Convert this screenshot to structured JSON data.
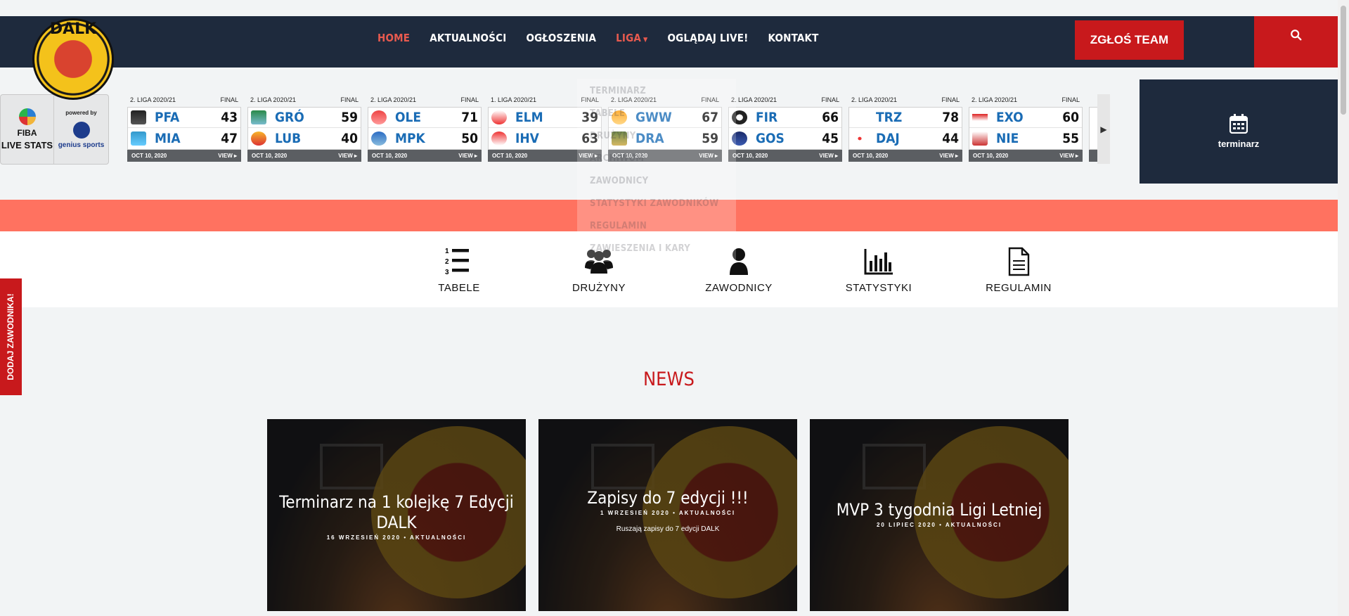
{
  "nav": {
    "home": "HOME",
    "aktualnosci": "AKTUALNOŚCI",
    "ogloszenia": "OGŁOSZENIA",
    "liga": "LIGA",
    "ogladaj": "OGLĄDAJ LIVE!",
    "kontakt": "KONTAKT"
  },
  "cta_label": "ZGŁOŚ TEAM",
  "logo_text": "DALK",
  "livestats": {
    "fiba": "FIBA",
    "title": "LIVE STATS",
    "powered": "powered by",
    "brand": "genius sports"
  },
  "games": [
    {
      "league": "2. LIGA 2020/21",
      "status": "FINAL",
      "date": "OCT 10, 2020",
      "view": "VIEW",
      "home": "PFA",
      "home_score": "43",
      "away": "MIA",
      "away_score": "47"
    },
    {
      "league": "2. LIGA 2020/21",
      "status": "FINAL",
      "date": "OCT 10, 2020",
      "view": "VIEW",
      "home": "GRÓ",
      "home_score": "59",
      "away": "LUB",
      "away_score": "40"
    },
    {
      "league": "2. LIGA 2020/21",
      "status": "FINAL",
      "date": "OCT 10, 2020",
      "view": "VIEW",
      "home": "OLE",
      "home_score": "71",
      "away": "MPK",
      "away_score": "50"
    },
    {
      "league": "1. LIGA 2020/21",
      "status": "FINAL",
      "date": "OCT 10, 2020",
      "view": "VIEW",
      "home": "ELM",
      "home_score": "39",
      "away": "IHV",
      "away_score": "63"
    },
    {
      "league": "2. LIGA 2020/21",
      "status": "FINAL",
      "date": "OCT 10, 2020",
      "view": "VIEW",
      "home": "GWW",
      "home_score": "67",
      "away": "DRA",
      "away_score": "59"
    },
    {
      "league": "2. LIGA 2020/21",
      "status": "FINAL",
      "date": "OCT 10, 2020",
      "view": "VIEW",
      "home": "FIR",
      "home_score": "66",
      "away": "GOS",
      "away_score": "45"
    },
    {
      "league": "2. LIGA 2020/21",
      "status": "FINAL",
      "date": "OCT 10, 2020",
      "view": "VIEW",
      "home": "TRZ",
      "home_score": "78",
      "away": "DAJ",
      "away_score": "44"
    },
    {
      "league": "2. LIGA 2020/21",
      "status": "FINAL",
      "date": "OCT 10, 2020",
      "view": "VIEW",
      "home": "EXO",
      "home_score": "60",
      "away": "NIE",
      "away_score": "55"
    }
  ],
  "terminarz_label": "terminarz",
  "dropdown": [
    "TERMINARZ",
    "TABELE",
    "DRUŻYNY",
    "ARCHIWUM",
    "ZAWODNICY",
    "STATYSTYKI ZAWODNIKÓW",
    "REGULAMIN",
    "ZAWIESZENIA I KARY"
  ],
  "iconbar": [
    "TABELE",
    "DRUŻYNY",
    "ZAWODNICY",
    "STATYSTYKI",
    "REGULAMIN"
  ],
  "side_tab": "DODAJ ZAWODNIKA!",
  "news_heading": "NEWS",
  "news": [
    {
      "title": "Terminarz na 1 kolejkę 7 Edycji DALK",
      "meta": "16 WRZESIEŃ 2020 • AKTUALNOŚCI",
      "excerpt": ""
    },
    {
      "title": "Zapisy do 7 edycji !!!",
      "meta": "1 WRZESIEŃ 2020 • AKTUALNOŚCI",
      "excerpt": "Ruszają zapisy do 7 edycji DALK"
    },
    {
      "title": "MVP 3 tygodnia Ligi Letniej",
      "meta": "20 LIPIEC 2020 • AKTUALNOŚCI",
      "excerpt": ""
    }
  ],
  "icons": {
    "search": "search-icon",
    "calendar": "calendar-icon",
    "tabele": "ordered-list-icon",
    "druzyny": "users-icon",
    "zawodnicy": "user-icon",
    "statystyki": "bar-chart-icon",
    "regulamin": "document-icon"
  },
  "colors": {
    "navy": "#1e2a3d",
    "red": "#c8191c",
    "coral": "#ff7260",
    "nav_active": "#e85a4f"
  }
}
